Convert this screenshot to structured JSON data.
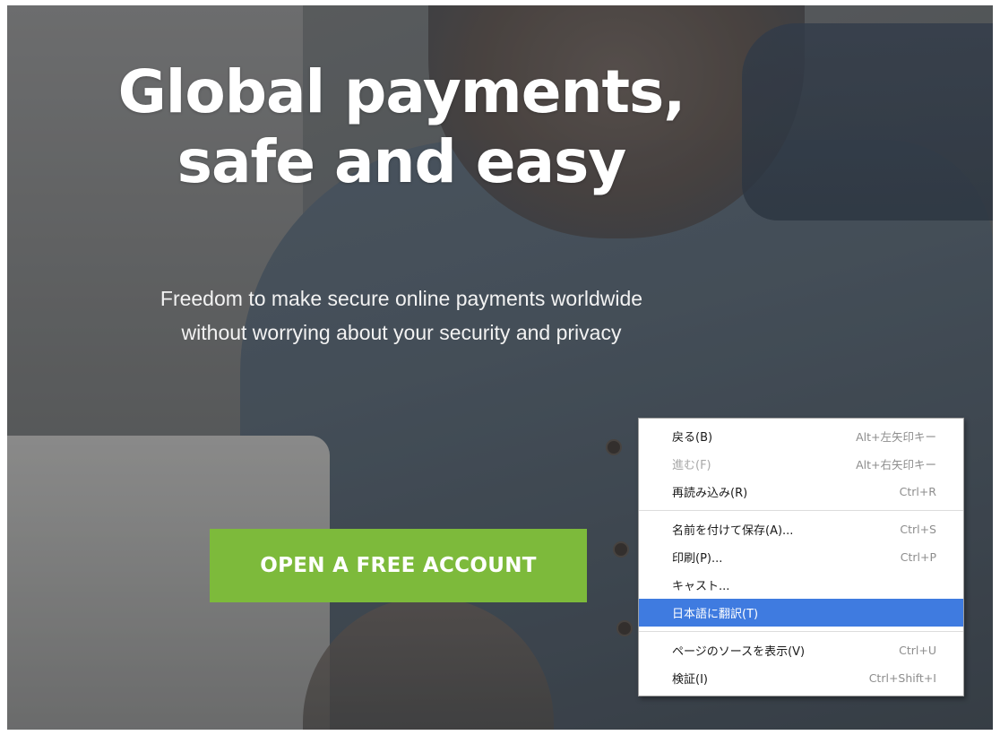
{
  "hero": {
    "headline_line1": "Global payments,",
    "headline_line2": "safe and easy",
    "subline_line1": "Freedom to make secure online payments worldwide",
    "subline_line2": "without worrying about your security and privacy",
    "cta_label": "OPEN A FREE ACCOUNT",
    "cta_color": "#7dba3b"
  },
  "context_menu": {
    "groups": [
      [
        {
          "label": "戻る(B)",
          "shortcut": "Alt+左矢印キー",
          "disabled": false
        },
        {
          "label": "進む(F)",
          "shortcut": "Alt+右矢印キー",
          "disabled": true
        },
        {
          "label": "再読み込み(R)",
          "shortcut": "Ctrl+R",
          "disabled": false
        }
      ],
      [
        {
          "label": "名前を付けて保存(A)...",
          "shortcut": "Ctrl+S",
          "disabled": false
        },
        {
          "label": "印刷(P)...",
          "shortcut": "Ctrl+P",
          "disabled": false
        },
        {
          "label": "キャスト...",
          "shortcut": "",
          "disabled": false
        },
        {
          "label": "日本語に翻訳(T)",
          "shortcut": "",
          "disabled": false,
          "highlighted": true
        }
      ],
      [
        {
          "label": "ページのソースを表示(V)",
          "shortcut": "Ctrl+U",
          "disabled": false
        },
        {
          "label": "検証(I)",
          "shortcut": "Ctrl+Shift+I",
          "disabled": false
        }
      ]
    ],
    "highlight_color": "#3f7be0"
  }
}
